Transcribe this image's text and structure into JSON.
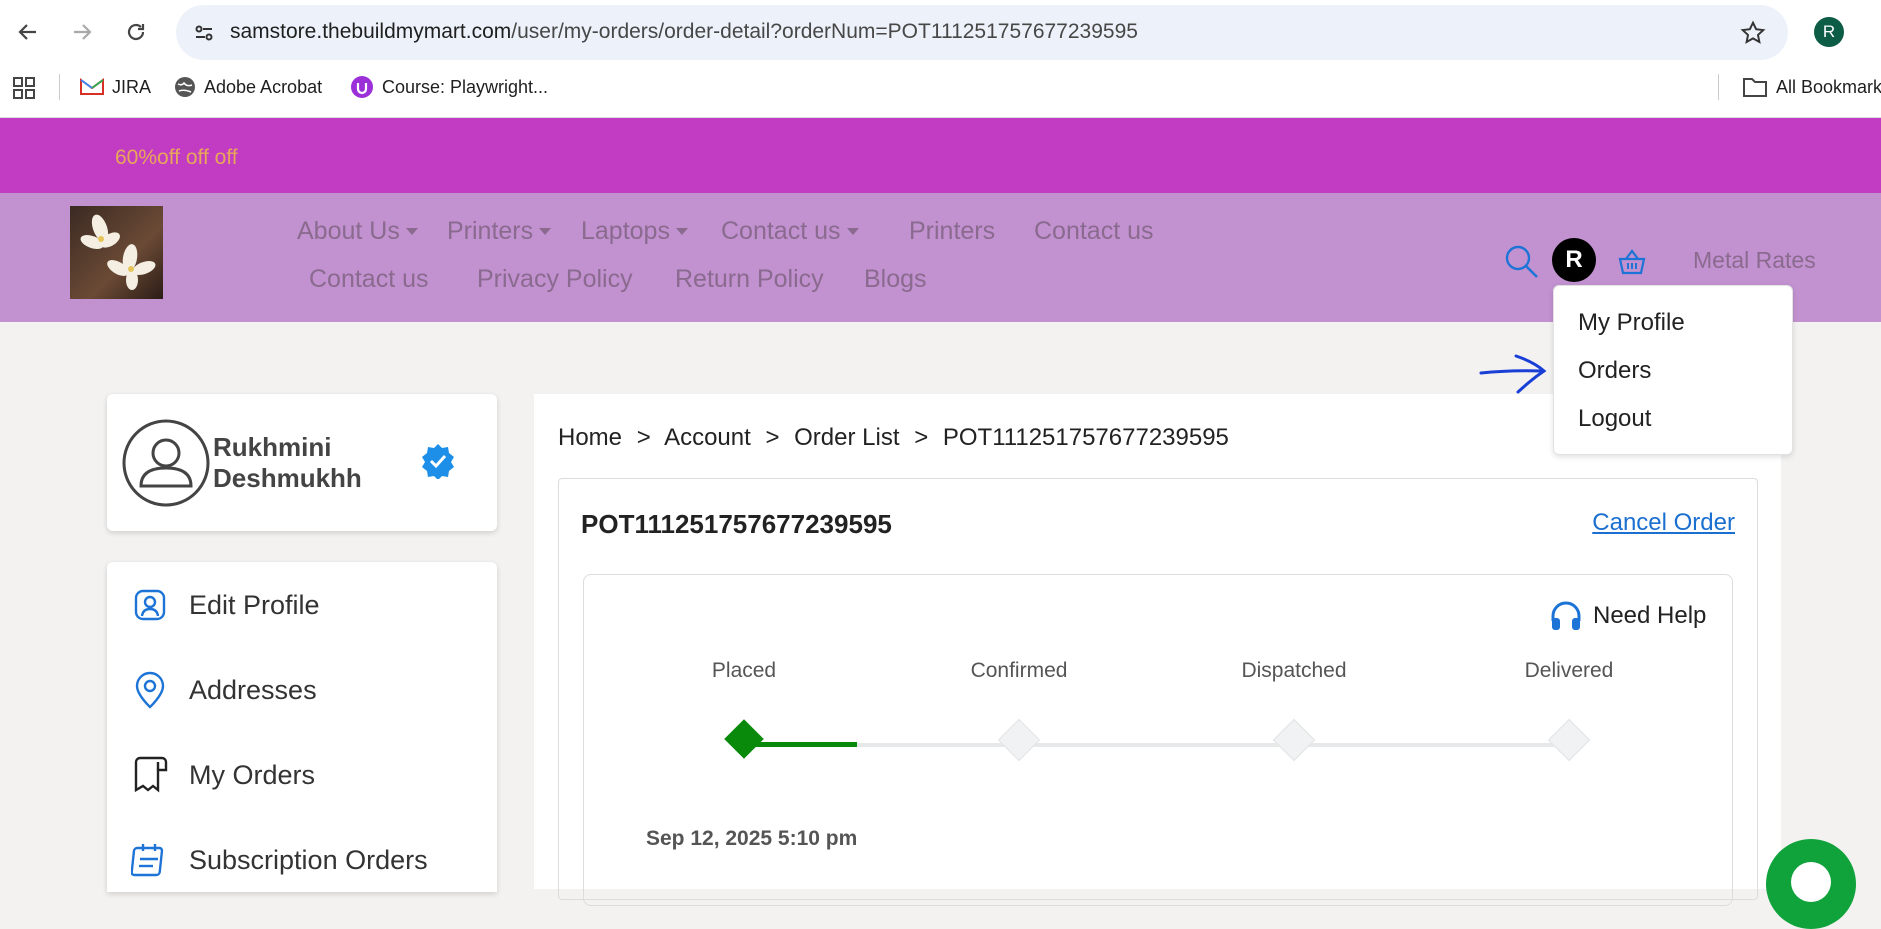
{
  "browser": {
    "url_host": "samstore.thebuildmymart.com",
    "url_path": "/user/my-orders/order-detail?orderNum=POT111251757677239595",
    "profile_initial": "R",
    "bookmarks": [
      {
        "label": "JIRA",
        "icon": "gmail-icon"
      },
      {
        "label": "Adobe Acrobat",
        "icon": "globe-icon"
      },
      {
        "label": "Course: Playwright...",
        "icon": "course-icon"
      }
    ],
    "all_bookmarks_label": "All Bookmarks"
  },
  "promo": {
    "text": "60%off off off",
    "bg": "#c13cc3",
    "color": "#e8a65a"
  },
  "nav": {
    "row1": [
      "About Us",
      "Printers",
      "Laptops",
      "Contact us",
      "Printers",
      "Contact us"
    ],
    "row2": [
      "Contact us",
      "Privacy Policy",
      "Return Policy",
      "Blogs"
    ],
    "avatar_initial": "R",
    "metal_rates": "Metal Rates",
    "bg": "#c292d0"
  },
  "user_menu": {
    "items": [
      "My Profile",
      "Orders",
      "Logout"
    ]
  },
  "profile": {
    "first_name": "Rukhmini",
    "last_name": "Deshmukhh"
  },
  "sidebar": {
    "items": [
      {
        "label": "Edit Profile",
        "icon": "user-square-icon"
      },
      {
        "label": "Addresses",
        "icon": "location-pin-icon"
      },
      {
        "label": "My Orders",
        "icon": "receipt-icon"
      },
      {
        "label": "Subscription Orders",
        "icon": "calendar-note-icon"
      }
    ]
  },
  "order": {
    "breadcrumb": {
      "home": "Home",
      "account": "Account",
      "order_list": "Order List",
      "current": "POT111251757677239595",
      "sep": ">"
    },
    "number": "POT111251757677239595",
    "cancel_label": "Cancel Order",
    "need_help": "Need Help",
    "steps": [
      "Placed",
      "Confirmed",
      "Dispatched",
      "Delivered"
    ],
    "completed_steps": 1,
    "date": "Sep 12, 2025 5:10 pm",
    "accent": "#0a8a0a"
  }
}
